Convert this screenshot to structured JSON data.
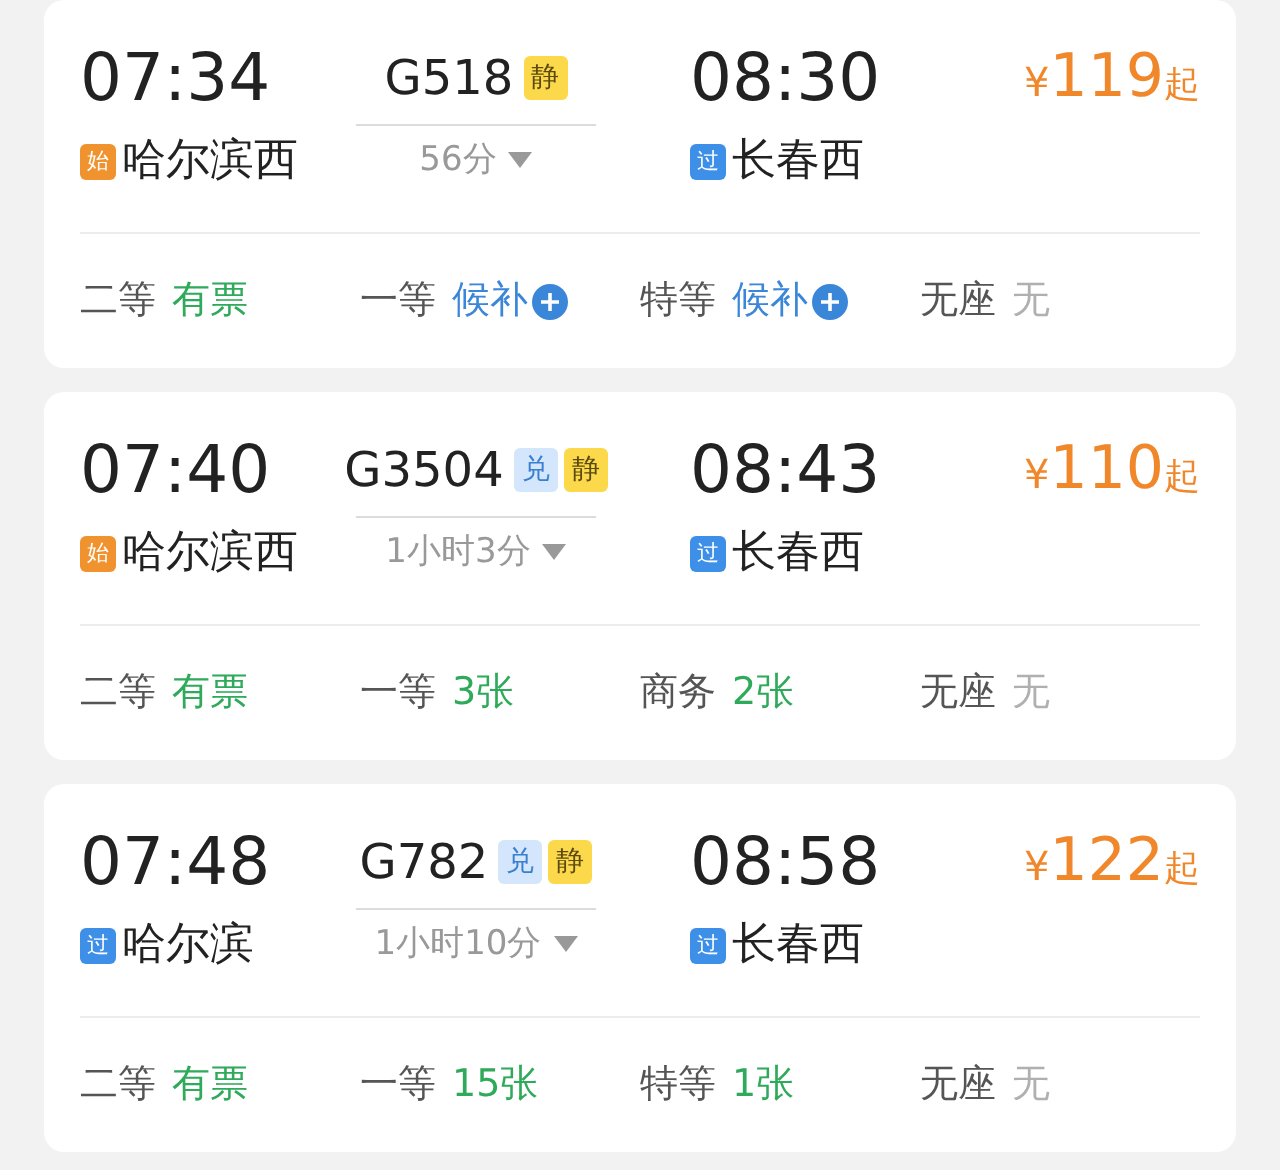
{
  "trains": [
    {
      "depart_time": "07:34",
      "depart_station": {
        "badge": "始",
        "kind": "start",
        "name": "哈尔滨西"
      },
      "number": "G518",
      "tags": [
        {
          "kind": "quiet",
          "label": "静"
        }
      ],
      "duration": "56分",
      "arrive_time": "08:30",
      "arrive_station": {
        "badge": "过",
        "kind": "pass",
        "name": "长春西"
      },
      "currency": "¥",
      "price": "119",
      "price_suffix": "起",
      "seats": [
        {
          "class": "二等",
          "status": "有票",
          "kind": "available"
        },
        {
          "class": "一等",
          "status": "候补",
          "kind": "waitlist"
        },
        {
          "class": "特等",
          "status": "候补",
          "kind": "waitlist"
        },
        {
          "class": "无座",
          "status": "无",
          "kind": "none"
        }
      ]
    },
    {
      "depart_time": "07:40",
      "depart_station": {
        "badge": "始",
        "kind": "start",
        "name": "哈尔滨西"
      },
      "number": "G3504",
      "tags": [
        {
          "kind": "exchange",
          "label": "兑"
        },
        {
          "kind": "quiet",
          "label": "静"
        }
      ],
      "duration": "1小时3分",
      "arrive_time": "08:43",
      "arrive_station": {
        "badge": "过",
        "kind": "pass",
        "name": "长春西"
      },
      "currency": "¥",
      "price": "110",
      "price_suffix": "起",
      "seats": [
        {
          "class": "二等",
          "status": "有票",
          "kind": "available"
        },
        {
          "class": "一等",
          "status": "3张",
          "kind": "available"
        },
        {
          "class": "商务",
          "status": "2张",
          "kind": "available"
        },
        {
          "class": "无座",
          "status": "无",
          "kind": "none"
        }
      ]
    },
    {
      "depart_time": "07:48",
      "depart_station": {
        "badge": "过",
        "kind": "pass",
        "name": "哈尔滨"
      },
      "number": "G782",
      "tags": [
        {
          "kind": "exchange",
          "label": "兑"
        },
        {
          "kind": "quiet",
          "label": "静"
        }
      ],
      "duration": "1小时10分",
      "arrive_time": "08:58",
      "arrive_station": {
        "badge": "过",
        "kind": "pass",
        "name": "长春西"
      },
      "currency": "¥",
      "price": "122",
      "price_suffix": "起",
      "seats": [
        {
          "class": "二等",
          "status": "有票",
          "kind": "available"
        },
        {
          "class": "一等",
          "status": "15张",
          "kind": "available"
        },
        {
          "class": "特等",
          "status": "1张",
          "kind": "available"
        },
        {
          "class": "无座",
          "status": "无",
          "kind": "none"
        }
      ]
    }
  ]
}
